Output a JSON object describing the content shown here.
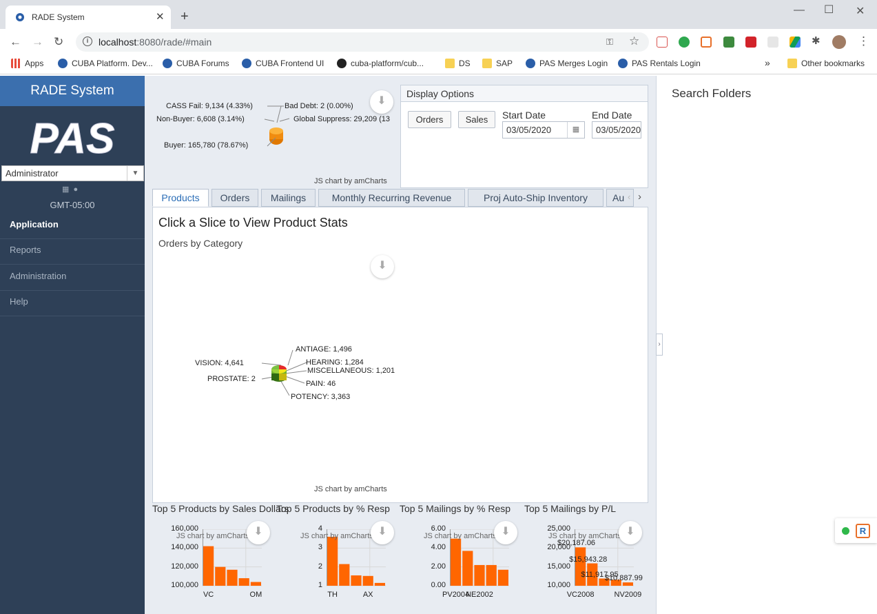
{
  "browser": {
    "tab_title": "RADE System",
    "url_host": "localhost",
    "url_rest": ":8080/rade/#main",
    "bookmarks": [
      {
        "label": "Apps",
        "color": "#e74c3c"
      },
      {
        "label": "CUBA Platform. Dev...",
        "color": "#2a5ea8"
      },
      {
        "label": "CUBA Forums",
        "color": "#2a5ea8"
      },
      {
        "label": "CUBA Frontend UI",
        "color": "#2a5ea8"
      },
      {
        "label": "cuba-platform/cub...",
        "color": "#222222"
      },
      {
        "label": "DS",
        "color": "#f7d154"
      },
      {
        "label": "SAP",
        "color": "#f7d154"
      },
      {
        "label": "PAS Merges Login",
        "color": "#2a5ea8"
      },
      {
        "label": "PAS Rentals Login",
        "color": "#2a5ea8"
      }
    ],
    "other_bookmarks": "Other bookmarks",
    "more_bookmarks": "»"
  },
  "sidebar": {
    "title": "RADE System",
    "logo_text": "PAS",
    "user_role": "Administrator",
    "timezone": "GMT-05:00",
    "menu": [
      {
        "label": "Application",
        "active": true
      },
      {
        "label": "Reports",
        "active": false
      },
      {
        "label": "Administration",
        "active": false
      },
      {
        "label": "Help",
        "active": false
      }
    ]
  },
  "top_chart": {
    "labels": {
      "cass": "CASS Fail: 9,134 (4.33%)",
      "bad_debt": "Bad Debt: 2 (0.00%)",
      "non_buyer": "Non-Buyer: 6,608 (3.14%)",
      "global": "Global Suppress: 29,209 (13",
      "buyer": "Buyer: 165,780 (78.67%)"
    },
    "credit": "JS chart by amCharts"
  },
  "display_options": {
    "title": "Display Options",
    "orders_button": "Orders",
    "sales_button": "Sales",
    "start_label": "Start Date",
    "start_value": "03/05/2020",
    "end_label": "End Date",
    "end_value": "03/05/2020"
  },
  "tabs": [
    {
      "label": "Products",
      "active": true
    },
    {
      "label": "Orders",
      "active": false
    },
    {
      "label": "Mailings",
      "active": false
    },
    {
      "label": "Monthly Recurring Revenue",
      "active": false
    },
    {
      "label": "Proj Auto-Ship Inventory",
      "active": false
    },
    {
      "label": "Au",
      "active": false
    }
  ],
  "products_panel": {
    "heading": "Click a Slice to View Product Stats",
    "subheading": "Orders by Category",
    "credit": "JS chart by amCharts",
    "slice_labels": {
      "antiage": "ANTIAGE: 1,496",
      "vision": "VISION: 4,641",
      "hearing": "HEARING: 1,284",
      "misc": "MISCELLANEOUS: 1,201",
      "prostate": "PROSTATE: 2",
      "pain": "PAIN: 46",
      "potency": "POTENCY: 3,363"
    }
  },
  "chart_data": [
    {
      "type": "pie",
      "title": "",
      "categories": [
        "CASS Fail",
        "Bad Debt",
        "Non-Buyer",
        "Global Suppress",
        "Buyer"
      ],
      "values": [
        9134,
        2,
        6608,
        29209,
        165780
      ],
      "percents": [
        4.33,
        0.0,
        3.14,
        null,
        78.67
      ]
    },
    {
      "type": "pie",
      "title": "Orders by Category",
      "categories": [
        "ANTIAGE",
        "VISION",
        "HEARING",
        "MISCELLANEOUS",
        "PROSTATE",
        "PAIN",
        "POTENCY"
      ],
      "values": [
        1496,
        4641,
        1284,
        1201,
        2,
        46,
        3363
      ]
    },
    {
      "type": "bar",
      "title": "Top 5 Products by Sales Dollars",
      "categories": [
        "VC",
        "",
        "",
        "",
        "OM"
      ],
      "values": [
        142000,
        120000,
        117000,
        108000,
        104000
      ],
      "ylim": [
        100000,
        160000
      ],
      "yticks": [
        "100,000",
        "120,000",
        "140,000",
        "160,000"
      ],
      "credit": "JS chart by amCharts"
    },
    {
      "type": "bar",
      "title": "Top 5 Products by % Resp",
      "categories": [
        "TH",
        "",
        "",
        "AX",
        ""
      ],
      "values": [
        3.6,
        2.15,
        1.55,
        1.52,
        1.15
      ],
      "ylim": [
        1,
        4
      ],
      "yticks": [
        "1",
        "2",
        "3",
        "4"
      ],
      "credit": "JS chart by amCharts"
    },
    {
      "type": "bar",
      "title": "Top 5 Mailings by % Resp",
      "categories": [
        "PV2004",
        "",
        "NE2002",
        "",
        ""
      ],
      "values": [
        5.0,
        3.7,
        2.2,
        2.2,
        1.7
      ],
      "ylim": [
        0,
        6
      ],
      "yticks": [
        "0.00",
        "2.00",
        "4.00",
        "6.00"
      ],
      "credit": "JS chart by amCharts"
    },
    {
      "type": "bar",
      "title": "Top 5 Mailings by P/L",
      "categories": [
        "VC2008",
        "",
        "",
        "",
        "NV2009"
      ],
      "values": [
        20187.06,
        15943.28,
        11917.95,
        11600,
        10887.99
      ],
      "data_labels": [
        "$20,187.06",
        "$15,943.28",
        "$11,917.95",
        "",
        "$10,887.99"
      ],
      "ylim": [
        10000,
        25000
      ],
      "yticks": [
        "10,000",
        "15,000",
        "20,000",
        "25,000"
      ],
      "credit": "JS chart by amCharts"
    }
  ],
  "right_panel": {
    "title": "Search Folders"
  },
  "colors": {
    "sidebar": "#2e4057",
    "sidebar_header": "#3b6fae",
    "bar": "#ff6600",
    "accent": "#2a6db6"
  }
}
